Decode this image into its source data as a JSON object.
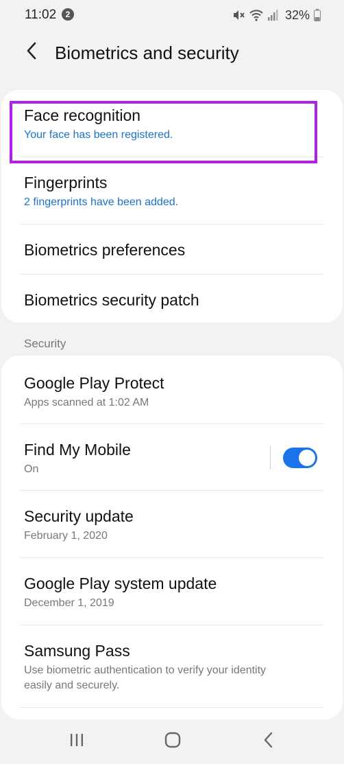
{
  "status_bar": {
    "time": "11:02",
    "notification_count": "2",
    "battery_percent": "32%"
  },
  "header": {
    "title": "Biometrics and security"
  },
  "biometrics": {
    "items": [
      {
        "title": "Face recognition",
        "subtitle": "Your face has been registered."
      },
      {
        "title": "Fingerprints",
        "subtitle": "2 fingerprints have been added."
      },
      {
        "title": "Biometrics preferences"
      },
      {
        "title": "Biometrics security patch"
      }
    ]
  },
  "security": {
    "section_label": "Security",
    "items": [
      {
        "title": "Google Play Protect",
        "subtitle": "Apps scanned at 1:02 AM"
      },
      {
        "title": "Find My Mobile",
        "subtitle": "On",
        "toggle_on": true
      },
      {
        "title": "Security update",
        "subtitle": "February 1, 2020"
      },
      {
        "title": "Google Play system update",
        "subtitle": "December 1, 2019"
      },
      {
        "title": "Samsung Pass",
        "subtitle_line1": "Use biometric authentication to verify your identity",
        "subtitle_line2": "easily and securely."
      }
    ]
  },
  "colors": {
    "accent": "#1a73e8",
    "link_blue": "#1a73c8",
    "highlight": "#b020e8",
    "background": "#f2f2f2"
  },
  "icons": [
    "back-icon",
    "mute-icon",
    "wifi-icon",
    "signal-icon",
    "battery-icon",
    "recents-icon",
    "home-icon",
    "nav-back-icon"
  ]
}
